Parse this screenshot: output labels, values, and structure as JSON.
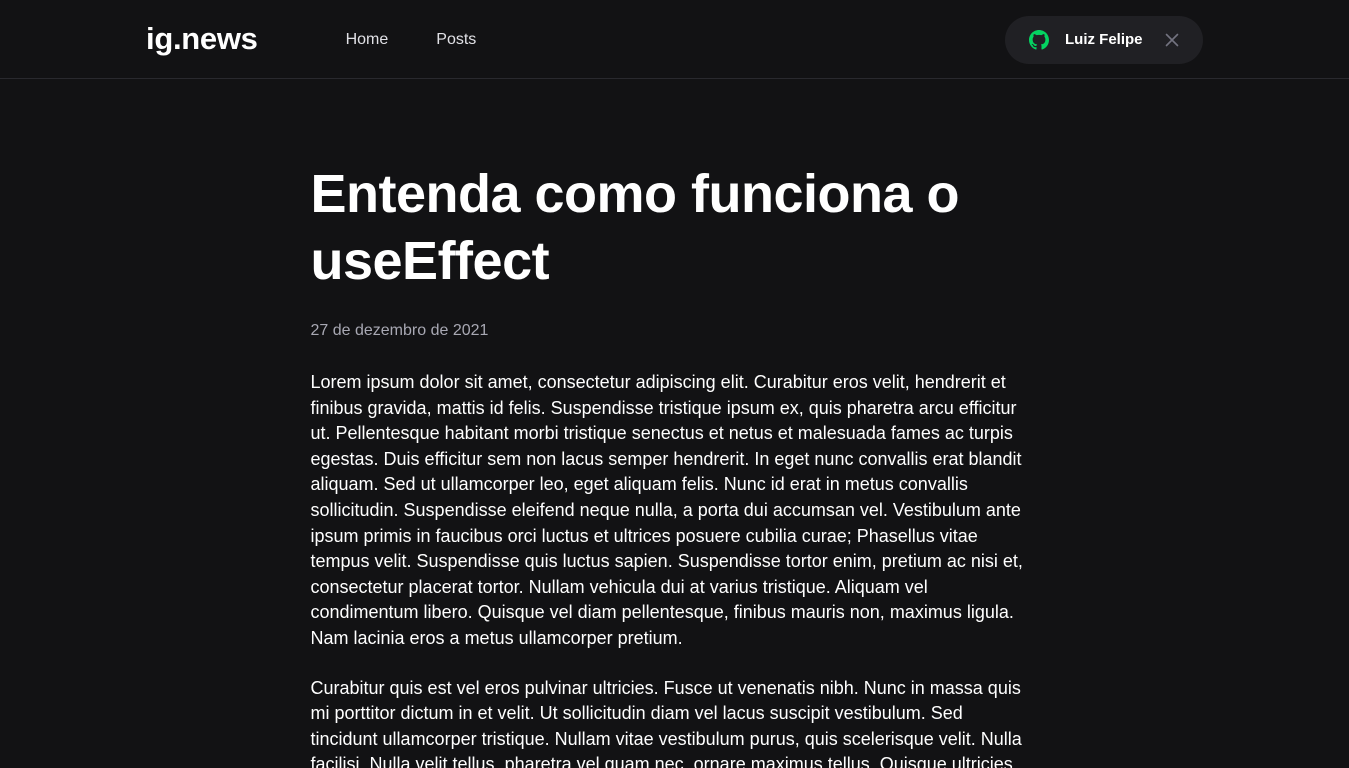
{
  "header": {
    "logo": "ig.news",
    "nav": [
      {
        "label": "Home"
      },
      {
        "label": "Posts"
      }
    ],
    "user": {
      "name": "Luiz Felipe",
      "icon": "github-icon",
      "close_icon": "close-icon"
    }
  },
  "post": {
    "title": "Entenda como funciona o useEffect",
    "date": "27 de dezembro de 2021",
    "paragraphs": [
      "Lorem ipsum dolor sit amet, consectetur adipiscing elit. Curabitur eros velit, hendrerit et finibus gravida, mattis id felis. Suspendisse tristique ipsum ex, quis pharetra arcu efficitur ut. Pellentesque habitant morbi tristique senectus et netus et malesuada fames ac turpis egestas. Duis efficitur sem non lacus semper hendrerit. In eget nunc convallis erat blandit aliquam. Sed ut ullamcorper leo, eget aliquam felis. Nunc id erat in metus convallis sollicitudin. Suspendisse eleifend neque nulla, a porta dui accumsan vel. Vestibulum ante ipsum primis in faucibus orci luctus et ultrices posuere cubilia curae; Phasellus vitae tempus velit. Suspendisse quis luctus sapien. Suspendisse tortor enim, pretium ac nisi et, consectetur placerat tortor. Nullam vehicula dui at varius tristique. Aliquam vel condimentum libero. Quisque vel diam pellentesque, finibus mauris non, maximus ligula. Nam lacinia eros a metus ullamcorper pretium.",
      "Curabitur quis est vel eros pulvinar ultricies. Fusce ut venenatis nibh. Nunc in massa quis mi porttitor dictum in et velit. Ut sollicitudin diam vel lacus suscipit vestibulum. Sed tincidunt ullamcorper tristique. Nullam vitae vestibulum purus, quis scelerisque velit. Nulla facilisi. Nulla velit tellus, pharetra vel quam nec, ornare maximus tellus. Quisque ultricies"
    ]
  },
  "colors": {
    "background": "#121214",
    "header_border": "#29292e",
    "user_button_bg": "#202024",
    "github_green": "#04d361",
    "close_gray": "#737380",
    "date_gray": "#a8a8b3"
  }
}
